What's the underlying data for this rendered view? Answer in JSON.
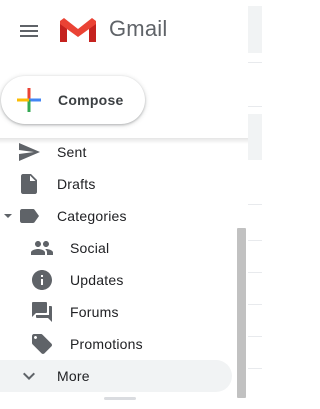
{
  "app": {
    "name": "Gmail"
  },
  "header": {
    "menu_icon": "hamburger-menu-icon",
    "logo_icon": "gmail-m-logo"
  },
  "compose": {
    "label": "Compose",
    "icon": "multicolor-plus-icon"
  },
  "nav": {
    "items": [
      {
        "label": "Sent",
        "icon": "send-icon"
      },
      {
        "label": "Drafts",
        "icon": "draft-file-icon"
      },
      {
        "label": "Categories",
        "icon": "label-icon",
        "expanded": true
      },
      {
        "label": "Social",
        "icon": "people-icon"
      },
      {
        "label": "Updates",
        "icon": "info-icon"
      },
      {
        "label": "Forums",
        "icon": "forum-icon"
      },
      {
        "label": "Promotions",
        "icon": "tag-icon"
      },
      {
        "label": "More",
        "icon": "chevron-down-icon",
        "highlighted": true
      }
    ]
  },
  "colors": {
    "gmail_red": "#EA4335",
    "gmail_dark_red": "#C5221F",
    "google_blue": "#4285F4",
    "google_green": "#34A853",
    "google_yellow": "#FBBC04",
    "icon_gray": "#5f6368",
    "hover_bg": "#f1f3f4"
  }
}
